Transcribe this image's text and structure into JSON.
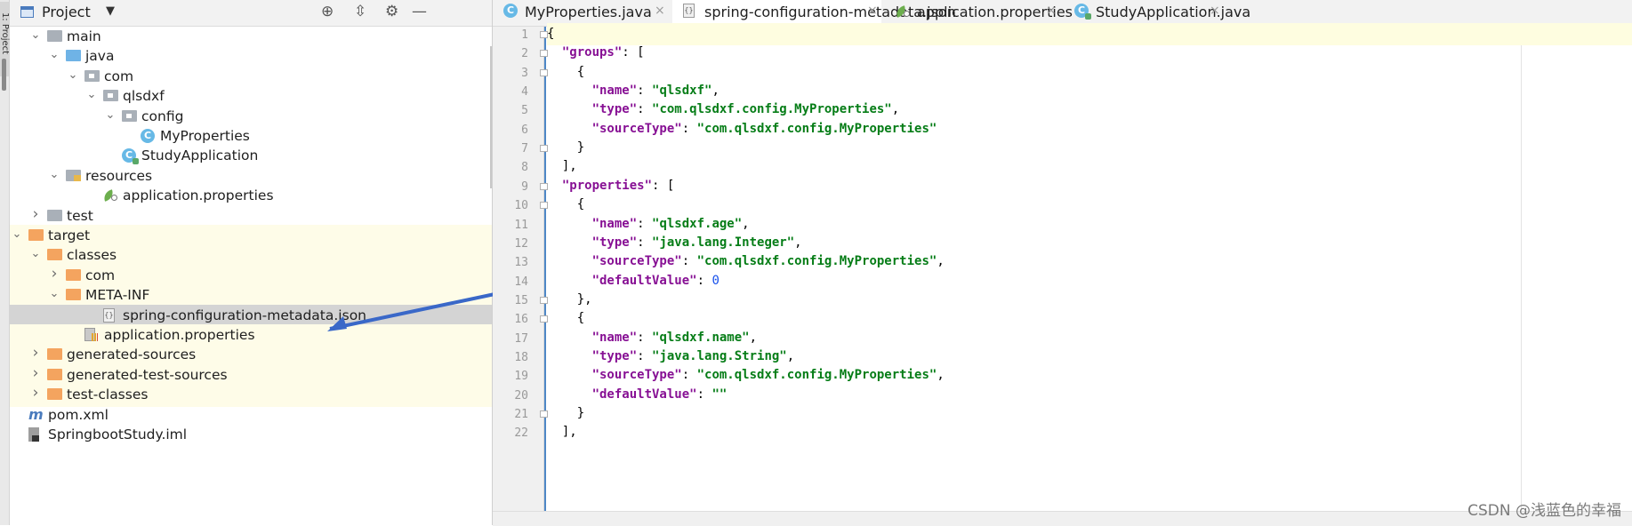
{
  "project_panel": {
    "title": "Project",
    "toolbar_icons": [
      "locate-icon",
      "collapse-icon",
      "gear-icon",
      "minimize-icon"
    ],
    "side_strip_label": "1: Project",
    "tree": [
      {
        "label": "main",
        "icon": "folder-gray",
        "expanded": true
      },
      {
        "label": "java",
        "icon": "folder-blue",
        "expanded": true
      },
      {
        "label": "com",
        "icon": "package",
        "expanded": true
      },
      {
        "label": "qlsdxf",
        "icon": "package",
        "expanded": true
      },
      {
        "label": "config",
        "icon": "package",
        "expanded": true
      },
      {
        "label": "MyProperties",
        "icon": "class"
      },
      {
        "label": "StudyApplication",
        "icon": "spring-class"
      },
      {
        "label": "resources",
        "icon": "resources-folder",
        "expanded": true
      },
      {
        "label": "application.properties",
        "icon": "spring-properties"
      },
      {
        "label": "test",
        "icon": "folder-gray",
        "expanded": false
      },
      {
        "label": "target",
        "icon": "folder-orange",
        "expanded": true
      },
      {
        "label": "classes",
        "icon": "folder-orange",
        "expanded": true
      },
      {
        "label": "com",
        "icon": "folder-orange",
        "expanded": false
      },
      {
        "label": "META-INF",
        "icon": "folder-orange",
        "expanded": true
      },
      {
        "label": "spring-configuration-metadata.json",
        "icon": "json-file",
        "selected": true
      },
      {
        "label": "application.properties",
        "icon": "properties-file"
      },
      {
        "label": "generated-sources",
        "icon": "folder-orange",
        "expanded": false
      },
      {
        "label": "generated-test-sources",
        "icon": "folder-orange",
        "expanded": false
      },
      {
        "label": "test-classes",
        "icon": "folder-orange",
        "expanded": false
      },
      {
        "label": "pom.xml",
        "icon": "maven-file"
      },
      {
        "label": "SpringbootStudy.iml",
        "icon": "iml-file"
      }
    ]
  },
  "editor": {
    "tabs": [
      {
        "label": "MyProperties.java",
        "icon": "class",
        "active": false
      },
      {
        "label": "spring-configuration-metadata.json",
        "icon": "json-file",
        "active": true
      },
      {
        "label": "application.properties",
        "icon": "spring-properties",
        "active": false
      },
      {
        "label": "StudyApplication.java",
        "icon": "spring-class",
        "active": false
      }
    ],
    "close_glyph": "×",
    "lines": [
      "{",
      "  \"groups\": [",
      "    {",
      "      \"name\": \"qlsdxf\",",
      "      \"type\": \"com.qlsdxf.config.MyProperties\",",
      "      \"sourceType\": \"com.qlsdxf.config.MyProperties\"",
      "    }",
      "  ],",
      "  \"properties\": [",
      "    {",
      "      \"name\": \"qlsdxf.age\",",
      "      \"type\": \"java.lang.Integer\",",
      "      \"sourceType\": \"com.qlsdxf.config.MyProperties\",",
      "      \"defaultValue\": 0",
      "    },",
      "    {",
      "      \"name\": \"qlsdxf.name\",",
      "      \"type\": \"java.lang.String\",",
      "      \"sourceType\": \"com.qlsdxf.config.MyProperties\",",
      "      \"defaultValue\": \"\"",
      "    }",
      "  ],"
    ]
  },
  "watermark": "CSDN @浅蓝色的幸福",
  "colors": {
    "key": "#871094",
    "string": "#067d17",
    "number": "#1750eb",
    "selection": "#d4d4d4",
    "highlight": "#fefce8",
    "arrow": "#3a68c8"
  }
}
